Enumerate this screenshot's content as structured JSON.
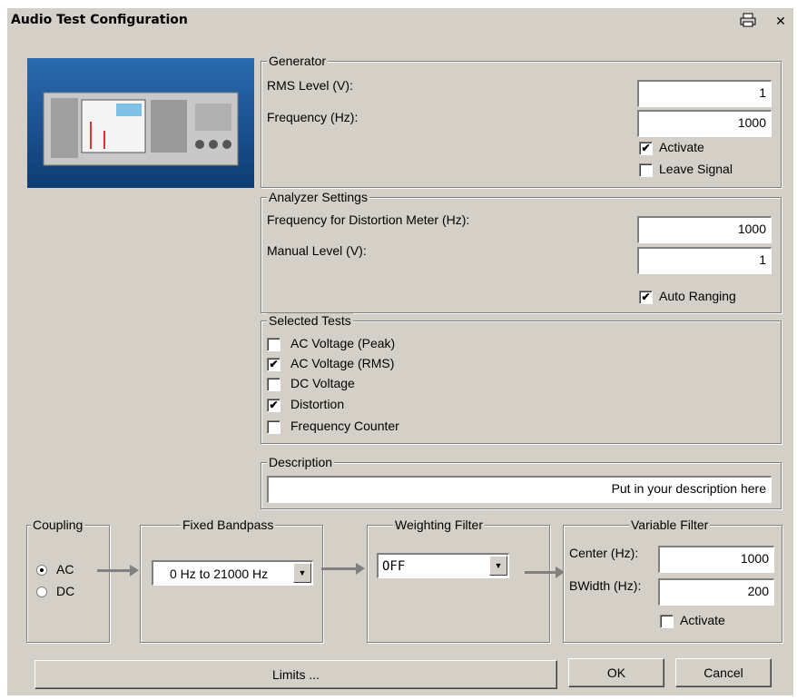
{
  "window": {
    "title": "Audio Test Configuration",
    "print_icon": "printer-icon",
    "close_glyph": "✕"
  },
  "generator": {
    "legend": "Generator",
    "rms_label": "RMS Level (V):",
    "rms_value": "1",
    "freq_label": "Frequency (Hz):",
    "freq_value": "1000",
    "activate_label": "Activate",
    "activate_checked": true,
    "leave_label": "Leave Signal",
    "leave_checked": false
  },
  "analyzer": {
    "legend": "Analyzer Settings",
    "dist_label": "Frequency for Distortion Meter (Hz):",
    "dist_value": "1000",
    "manual_label": "Manual Level (V):",
    "manual_value": "1",
    "auto_label": "Auto Ranging",
    "auto_checked": true
  },
  "tests": {
    "legend": "Selected Tests",
    "items": [
      {
        "label": "AC Voltage (Peak)",
        "checked": false
      },
      {
        "label": "AC Voltage (RMS)",
        "checked": true
      },
      {
        "label": "DC Voltage",
        "checked": false
      },
      {
        "label": "Distortion",
        "checked": true
      },
      {
        "label": "Frequency Counter",
        "checked": false
      }
    ]
  },
  "description": {
    "legend": "Description",
    "value": "Put in your description here"
  },
  "coupling": {
    "legend": "Coupling",
    "ac": "AC",
    "dc": "DC",
    "selected": "AC"
  },
  "bandpass": {
    "legend": "Fixed Bandpass",
    "value": "0 Hz to 21000 Hz"
  },
  "weighting": {
    "legend": "Weighting Filter",
    "value": "OFF"
  },
  "variable": {
    "legend": "Variable Filter",
    "center_label": "Center (Hz):",
    "center_value": "1000",
    "bwidth_label": "BWidth (Hz):",
    "bwidth_value": "200",
    "activate_label": "Activate",
    "activate_checked": false
  },
  "buttons": {
    "limits": "Limits ...",
    "ok": "OK",
    "cancel": "Cancel"
  },
  "check_glyph": "✔",
  "colors": {
    "dialog_bg": "#d4d0c8",
    "photo_bg": "#1d5a9a"
  }
}
